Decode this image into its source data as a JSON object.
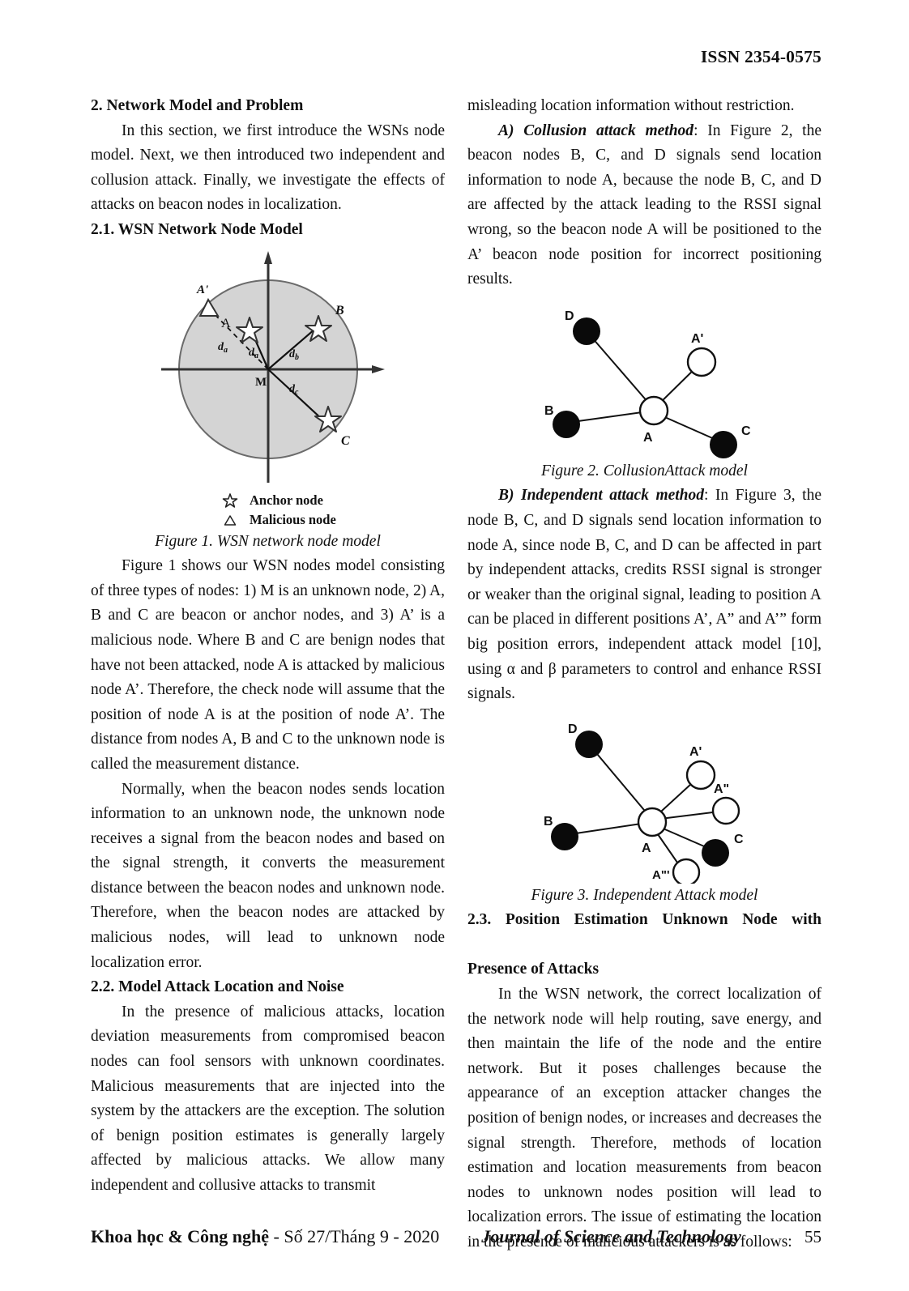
{
  "header": {
    "issn": "ISSN 2354-0575"
  },
  "left_column": {
    "section2_heading": "2. Network Model and Problem",
    "intro_paragraph": "In this section, we first introduce the WSNs node model. Next, we then introduced two independent and collusion attack. Finally, we investigate the effects of attacks on beacon nodes in localization.",
    "section21_heading": "2.1. WSN Network Node Model",
    "figure1": {
      "caption": "Figure 1. WSN network node model",
      "legend": [
        {
          "glyph": "star-icon",
          "label": "Anchor node"
        },
        {
          "glyph": "triangle-icon",
          "label": "Malicious node"
        }
      ],
      "nodes": [
        {
          "id": "A'",
          "type": "malicious-triangle"
        },
        {
          "id": "A",
          "type": "anchor-star"
        },
        {
          "id": "B",
          "type": "anchor-star"
        },
        {
          "id": "C",
          "type": "anchor-star"
        },
        {
          "id": "M",
          "type": "unknown-node"
        }
      ],
      "distance_labels": [
        "da",
        "da",
        "db",
        "dc"
      ],
      "circle_fill": "#d4d4d4"
    },
    "paragraph_fig1": "Figure 1 shows our WSN nodes model consisting of three types of nodes: 1) M is an unknown node, 2) A, B and C are beacon or anchor nodes, and 3) A’ is a malicious node. Where B and C are benign nodes that have not been attacked, node A is attacked by malicious node A’. Therefore, the check node will assume that the position of node A is at the position of node A’. The distance from nodes A, B and C to the unknown node is called the measurement distance.",
    "paragraph_normally": "Normally, when the beacon nodes sends location information to an unknown node, the unknown node receives a signal from the beacon nodes and based on the signal strength, it converts the measurement distance between the beacon nodes and unknown node. Therefore, when the beacon nodes are attacked by malicious nodes, will lead to unknown node localization error.",
    "section22_heading": "2.2. Model Attack Location and Noise",
    "paragraph_22": "In the presence of malicious attacks, location deviation measurements from compromised beacon nodes can fool sensors with unknown coordinates. Malicious measurements that are injected into the system by the attackers are the exception. The solution of benign position estimates is generally largely affected by malicious attacks. We allow many independent and collusive attacks to transmit"
  },
  "right_column": {
    "paragraph_continued": "misleading location information without restriction.",
    "collusion_label": "A)  Collusion attack method",
    "collusion_text": ": In Figure 2, the beacon nodes B, C, and D signals send location information to node A, because the node B, C, and D are affected by the attack leading to the RSSI signal wrong, so the beacon node A will be positioned to the A’ beacon node position for incorrect positioning results.",
    "figure2": {
      "caption": "Figure 2. CollusionAttack model",
      "nodes": [
        {
          "id": "D",
          "type": "filled"
        },
        {
          "id": "A'",
          "type": "hollow"
        },
        {
          "id": "B",
          "type": "filled"
        },
        {
          "id": "A",
          "type": "hollow"
        },
        {
          "id": "C",
          "type": "filled"
        }
      ]
    },
    "independent_label": "B)  Independent attack method",
    "independent_text": ": In Figure 3, the node B, C, and D signals send location information to node A, since node B, C, and D can be affected in part by independent attacks, credits RSSI signal is stronger or weaker than the original signal, leading to position A can be placed in different positions A’, A” and A’” form big position errors, independent attack model [10], using α and β parameters to control and enhance RSSI signals.",
    "figure3": {
      "caption": "Figure 3. Independent Attack model",
      "nodes": [
        {
          "id": "D",
          "type": "filled"
        },
        {
          "id": "A'",
          "type": "hollow"
        },
        {
          "id": "A\"",
          "type": "hollow"
        },
        {
          "id": "B",
          "type": "filled"
        },
        {
          "id": "A",
          "type": "hollow"
        },
        {
          "id": "C",
          "type": "filled"
        },
        {
          "id": "A\"'",
          "type": "hollow"
        }
      ]
    },
    "section23_heading_line1": "2.3. Position Estimation Unknown Node with",
    "section23_heading_line2": "Presence of Attacks",
    "paragraph_23": "In the WSN network, the correct localization of the network node will help routing, save energy, and then maintain the life of the node and the entire network. But it poses challenges because the appearance of an exception attacker changes the position of benign nodes, or increases and decreases the signal strength. Therefore, methods of location estimation and location measurements from beacon nodes to unknown nodes position will lead to localization errors. The issue of estimating the location in the presence of malicious attackers is as follows:"
  },
  "footer": {
    "journal_vi_bold": "Khoa học & Công nghệ",
    "journal_vi_rest": " - Số 27/Tháng 9 - 2020",
    "journal_en": "Journal of Science and Technology",
    "page_number": "55"
  }
}
